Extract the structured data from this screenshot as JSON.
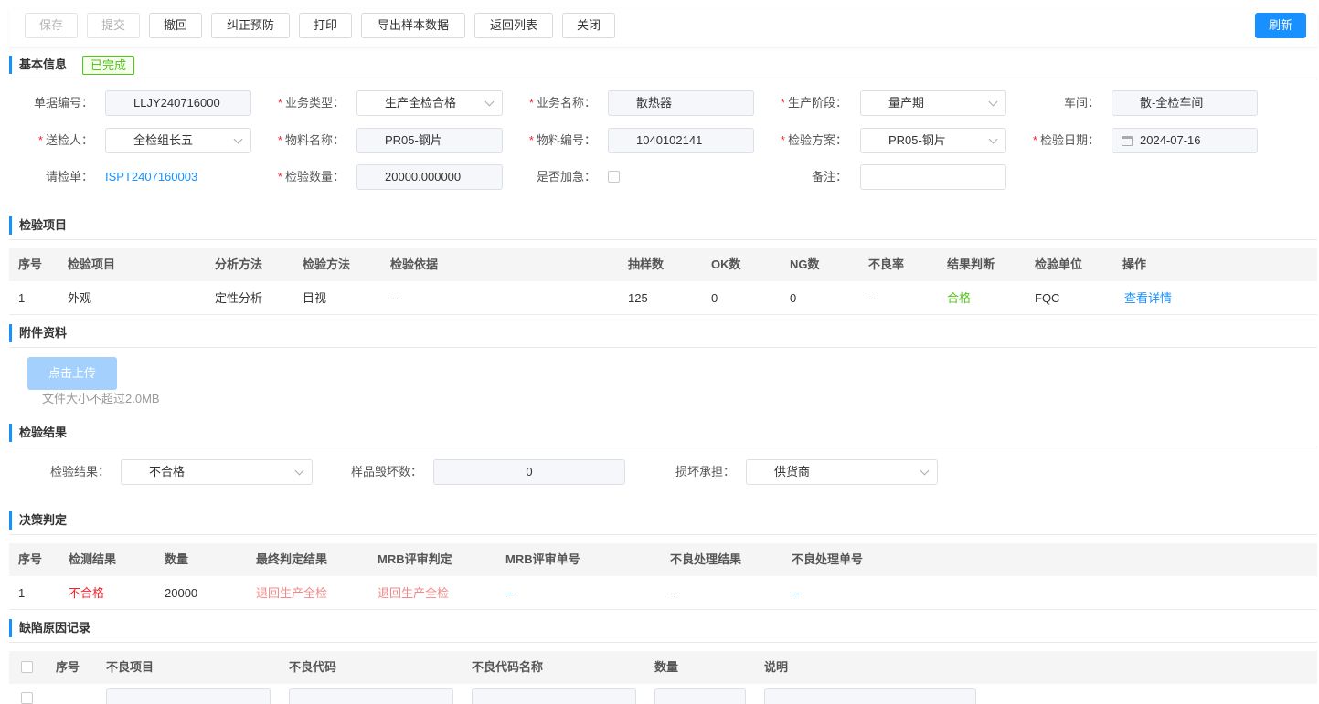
{
  "toolbar": {
    "save": "保存",
    "submit": "提交",
    "withdraw": "撤回",
    "corrective": "纠正预防",
    "print": "打印",
    "export": "导出样本数据",
    "back": "返回列表",
    "close": "关闭",
    "refresh": "刷新"
  },
  "basic": {
    "title": "基本信息",
    "status": "已完成",
    "fields": {
      "doc_no_label": "单据编号：",
      "doc_no": "LLJY240716000",
      "biz_type_label": "业务类型：",
      "biz_type": "生产全检合格",
      "biz_name_label": "业务名称：",
      "biz_name": "散热器",
      "stage_label": "生产阶段：",
      "stage": "量产期",
      "workshop_label": "车间：",
      "workshop": "散-全检车间",
      "sender_label": "送检人：",
      "sender": "全检组长五",
      "material_name_label": "物料名称：",
      "material_name": "PR05-钢片",
      "material_no_label": "物料编号：",
      "material_no": "1040102141",
      "plan_label": "检验方案：",
      "plan": "PR05-钢片",
      "date_label": "检验日期：",
      "date": "2024-07-16",
      "request_label": "请检单：",
      "request": "ISPT2407160003",
      "qty_label": "检验数量：",
      "qty": "20000.000000",
      "urgent_label": "是否加急：",
      "remark_label": "备注：",
      "remark": ""
    }
  },
  "inspection_items": {
    "title": "检验项目",
    "headers": [
      "序号",
      "检验项目",
      "分析方法",
      "检验方法",
      "检验依据",
      "抽样数",
      "OK数",
      "NG数",
      "不良率",
      "结果判断",
      "检验单位",
      "操作"
    ],
    "rows": [
      [
        "1",
        "外观",
        "定性分析",
        "目视",
        "--",
        "125",
        "0",
        "0",
        "--",
        "合格",
        "FQC",
        "查看详情"
      ]
    ]
  },
  "attachments": {
    "title": "附件资料",
    "upload": "点击上传",
    "hint": "文件大小不超过2.0MB"
  },
  "result": {
    "title": "检验结果",
    "result_label": "检验结果：",
    "result_value": "不合格",
    "damage_label": "样品毁坏数：",
    "damage_value": "0",
    "bearer_label": "损坏承担：",
    "bearer_value": "供货商"
  },
  "decision": {
    "title": "决策判定",
    "headers": [
      "序号",
      "检测结果",
      "数量",
      "最终判定结果",
      "MRB评审判定",
      "MRB评审单号",
      "不良处理结果",
      "不良处理单号"
    ],
    "rows": [
      [
        "1",
        "不合格",
        "20000",
        "退回生产全检",
        "退回生产全检",
        "--",
        "--",
        "--"
      ]
    ]
  },
  "defects": {
    "title": "缺陷原因记录",
    "headers": [
      "序号",
      "不良项目",
      "不良代码",
      "不良代码名称",
      "数量",
      "说明"
    ]
  },
  "colors": {
    "primary": "#1890ff",
    "success": "#52c41a",
    "danger": "#f5222d"
  }
}
